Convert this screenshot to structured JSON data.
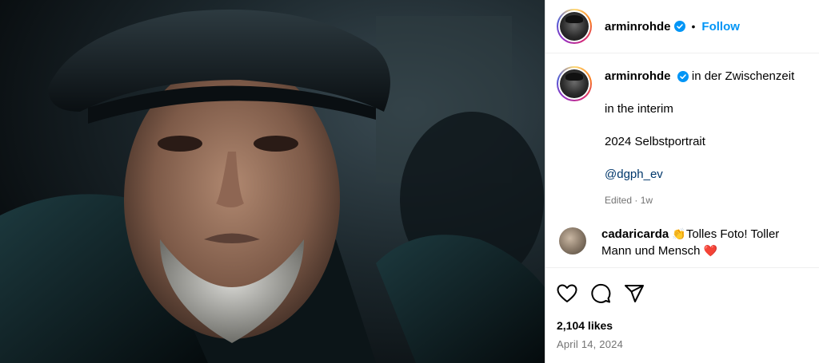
{
  "header": {
    "username": "arminrohde",
    "separator": "•",
    "follow_label": "Follow"
  },
  "caption": {
    "username": "arminrohde",
    "line1": "in der Zwischenzeit",
    "line2": "in the interim",
    "line3": "2024 Selbstportrait",
    "mention": "@dgph_ev",
    "meta": "Edited · 1w"
  },
  "comment": {
    "username": "cadaricarda",
    "emoji_clap": "👏",
    "text": "Tolles Foto! Toller Mann und Mensch",
    "emoji_heart": "❤️"
  },
  "footer": {
    "likes": "2,104 likes",
    "date": "April 14, 2024"
  },
  "icons": {
    "like": "heart-icon",
    "comment": "comment-icon",
    "share": "share-icon",
    "verified": "verified-badge-icon"
  },
  "colors": {
    "follow": "#0095f6",
    "verified": "#0095f6",
    "mention": "#00376b",
    "muted": "#737373"
  }
}
